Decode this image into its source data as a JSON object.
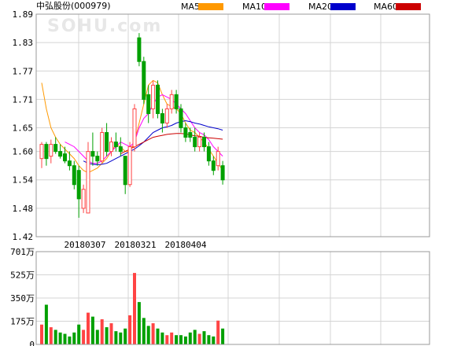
{
  "chart_data": {
    "type": "candlestick",
    "title": "中弘股份(000979)",
    "watermark": "SOHU.com",
    "legend": [
      {
        "name": "MA5",
        "color": "#ff9900"
      },
      {
        "name": "MA10",
        "color": "#ff00ff"
      },
      {
        "name": "MA20",
        "color": "#0000cc"
      },
      {
        "name": "MA60",
        "color": "#cc0000"
      }
    ],
    "price_axis": {
      "ticks": [
        1.89,
        1.83,
        1.77,
        1.71,
        1.65,
        1.6,
        1.54,
        1.48,
        1.42
      ],
      "ylim": [
        1.42,
        1.89
      ]
    },
    "volume_axis": {
      "ticks": [
        "701万",
        "525万",
        "350万",
        "175万",
        "0"
      ],
      "ylim": [
        0,
        701
      ]
    },
    "date_labels": [
      "20180307",
      "20180321",
      "20180404"
    ],
    "up_color": "#ff4444",
    "down_color": "#00a000",
    "candles": [
      {
        "o": 1.585,
        "h": 1.62,
        "l": 1.565,
        "c": 1.615,
        "v": 150
      },
      {
        "o": 1.615,
        "h": 1.62,
        "l": 1.57,
        "c": 1.585,
        "v": 300
      },
      {
        "o": 1.59,
        "h": 1.625,
        "l": 1.575,
        "c": 1.615,
        "v": 130
      },
      {
        "o": 1.615,
        "h": 1.63,
        "l": 1.595,
        "c": 1.6,
        "v": 110
      },
      {
        "o": 1.6,
        "h": 1.615,
        "l": 1.585,
        "c": 1.59,
        "v": 90
      },
      {
        "o": 1.595,
        "h": 1.61,
        "l": 1.575,
        "c": 1.58,
        "v": 80
      },
      {
        "o": 1.58,
        "h": 1.6,
        "l": 1.56,
        "c": 1.57,
        "v": 60
      },
      {
        "o": 1.57,
        "h": 1.58,
        "l": 1.52,
        "c": 1.53,
        "v": 90
      },
      {
        "o": 1.56,
        "h": 1.57,
        "l": 1.46,
        "c": 1.5,
        "v": 150
      },
      {
        "o": 1.48,
        "h": 1.53,
        "l": 1.47,
        "c": 1.52,
        "v": 110
      },
      {
        "o": 1.47,
        "h": 1.62,
        "l": 1.47,
        "c": 1.6,
        "v": 240
      },
      {
        "o": 1.6,
        "h": 1.64,
        "l": 1.57,
        "c": 1.59,
        "v": 210
      },
      {
        "o": 1.59,
        "h": 1.6,
        "l": 1.57,
        "c": 1.58,
        "v": 110
      },
      {
        "o": 1.58,
        "h": 1.65,
        "l": 1.575,
        "c": 1.64,
        "v": 190
      },
      {
        "o": 1.64,
        "h": 1.66,
        "l": 1.59,
        "c": 1.6,
        "v": 130
      },
      {
        "o": 1.6,
        "h": 1.63,
        "l": 1.59,
        "c": 1.62,
        "v": 160
      },
      {
        "o": 1.62,
        "h": 1.64,
        "l": 1.6,
        "c": 1.61,
        "v": 100
      },
      {
        "o": 1.61,
        "h": 1.63,
        "l": 1.59,
        "c": 1.6,
        "v": 90
      },
      {
        "o": 1.59,
        "h": 1.59,
        "l": 1.51,
        "c": 1.53,
        "v": 120
      },
      {
        "o": 1.53,
        "h": 1.62,
        "l": 1.525,
        "c": 1.61,
        "v": 220
      },
      {
        "o": 1.61,
        "h": 1.7,
        "l": 1.6,
        "c": 1.69,
        "v": 540
      },
      {
        "o": 1.84,
        "h": 1.85,
        "l": 1.78,
        "c": 1.79,
        "v": 320
      },
      {
        "o": 1.79,
        "h": 1.8,
        "l": 1.7,
        "c": 1.71,
        "v": 200
      },
      {
        "o": 1.72,
        "h": 1.74,
        "l": 1.66,
        "c": 1.68,
        "v": 140
      },
      {
        "o": 1.69,
        "h": 1.75,
        "l": 1.67,
        "c": 1.74,
        "v": 160
      },
      {
        "o": 1.74,
        "h": 1.75,
        "l": 1.67,
        "c": 1.68,
        "v": 120
      },
      {
        "o": 1.68,
        "h": 1.69,
        "l": 1.64,
        "c": 1.66,
        "v": 90
      },
      {
        "o": 1.66,
        "h": 1.7,
        "l": 1.65,
        "c": 1.69,
        "v": 70
      },
      {
        "o": 1.69,
        "h": 1.73,
        "l": 1.68,
        "c": 1.72,
        "v": 90
      },
      {
        "o": 1.72,
        "h": 1.73,
        "l": 1.68,
        "c": 1.69,
        "v": 70
      },
      {
        "o": 1.69,
        "h": 1.7,
        "l": 1.64,
        "c": 1.65,
        "v": 70
      },
      {
        "o": 1.65,
        "h": 1.66,
        "l": 1.62,
        "c": 1.63,
        "v": 60
      },
      {
        "o": 1.64,
        "h": 1.65,
        "l": 1.62,
        "c": 1.63,
        "v": 90
      },
      {
        "o": 1.63,
        "h": 1.65,
        "l": 1.6,
        "c": 1.61,
        "v": 110
      },
      {
        "o": 1.61,
        "h": 1.64,
        "l": 1.6,
        "c": 1.63,
        "v": 80
      },
      {
        "o": 1.63,
        "h": 1.64,
        "l": 1.6,
        "c": 1.61,
        "v": 100
      },
      {
        "o": 1.61,
        "h": 1.62,
        "l": 1.57,
        "c": 1.58,
        "v": 70
      },
      {
        "o": 1.58,
        "h": 1.59,
        "l": 1.55,
        "c": 1.56,
        "v": 60
      },
      {
        "o": 1.57,
        "h": 1.61,
        "l": 1.56,
        "c": 1.6,
        "v": 180
      },
      {
        "o": 1.57,
        "h": 1.58,
        "l": 1.53,
        "c": 1.54,
        "v": 120
      }
    ],
    "ma5": [
      1.745,
      1.69,
      1.65,
      1.63,
      1.615,
      1.605,
      1.595,
      1.585,
      1.57,
      1.56,
      1.555,
      1.56,
      1.565,
      1.575,
      1.585,
      1.6,
      1.615,
      1.61,
      1.6,
      1.6,
      1.62,
      1.66,
      1.7,
      1.74,
      1.75,
      1.745,
      1.72,
      1.7,
      1.695,
      1.69,
      1.68,
      1.66,
      1.645,
      1.64,
      1.63,
      1.62,
      1.605,
      1.59,
      1.575,
      1.56
    ],
    "ma10": [
      null,
      null,
      null,
      null,
      null,
      1.62,
      1.615,
      1.61,
      1.6,
      1.59,
      1.58,
      1.575,
      1.575,
      1.58,
      1.59,
      1.6,
      1.61,
      1.62,
      1.615,
      1.61,
      1.62,
      1.65,
      1.67,
      1.68,
      1.7,
      1.715,
      1.72,
      1.715,
      1.71,
      1.7,
      1.69,
      1.68,
      1.665,
      1.65,
      1.64,
      1.635,
      1.625,
      1.61,
      1.6,
      1.59
    ],
    "ma20": [
      null,
      null,
      null,
      null,
      null,
      null,
      null,
      null,
      null,
      1.58,
      1.575,
      1.573,
      1.572,
      1.573,
      1.575,
      1.58,
      1.585,
      1.59,
      1.595,
      1.6,
      1.605,
      1.612,
      1.62,
      1.63,
      1.64,
      1.645,
      1.65,
      1.652,
      1.655,
      1.66,
      1.663,
      1.665,
      1.663,
      1.66,
      1.658,
      1.655,
      1.652,
      1.65,
      1.648,
      1.645
    ],
    "ma60": [
      null,
      null,
      null,
      null,
      null,
      null,
      null,
      null,
      null,
      null,
      null,
      null,
      null,
      null,
      null,
      null,
      null,
      1.595,
      1.6,
      1.605,
      1.61,
      1.615,
      1.62,
      1.625,
      1.63,
      1.632,
      1.634,
      1.636,
      1.637,
      1.638,
      1.638,
      1.637,
      1.635,
      1.633,
      1.632,
      1.63,
      1.629,
      1.628,
      1.627,
      1.626
    ]
  }
}
